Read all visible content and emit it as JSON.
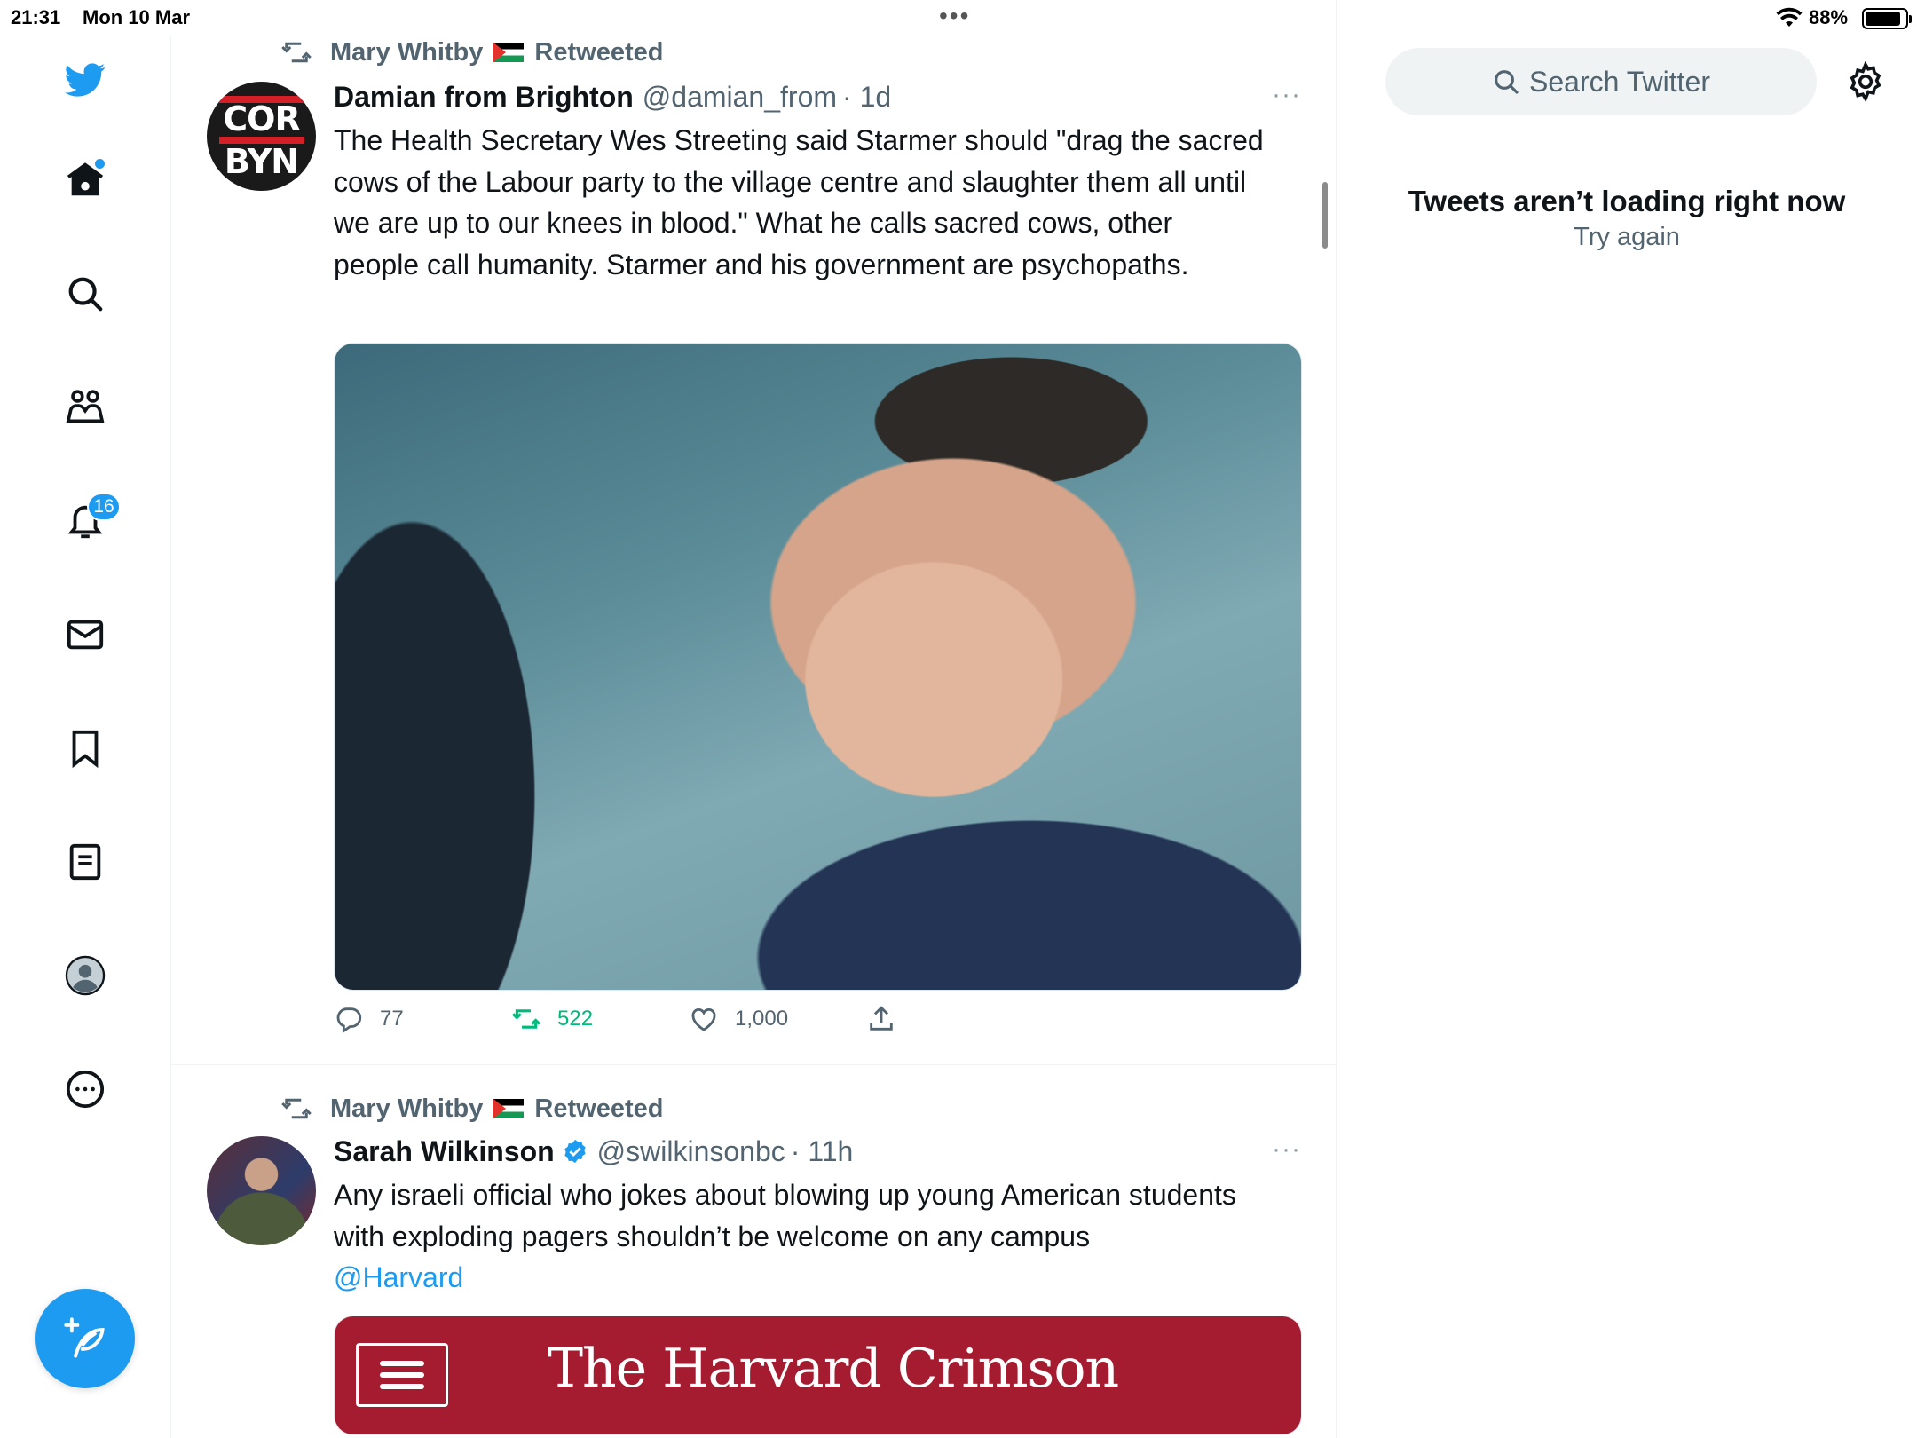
{
  "status_bar": {
    "time": "21:31",
    "date": "Mon 10 Mar",
    "battery_pct": "88%",
    "battery_level": 0.88
  },
  "sidebar": {
    "items": [
      {
        "icon": "twitter-bird-icon"
      },
      {
        "icon": "home-icon",
        "has_dot": true
      },
      {
        "icon": "search-icon"
      },
      {
        "icon": "communities-icon"
      },
      {
        "icon": "notifications-bell-icon",
        "badge": "16"
      },
      {
        "icon": "messages-envelope-icon"
      },
      {
        "icon": "bookmark-icon"
      },
      {
        "icon": "lists-icon"
      },
      {
        "icon": "profile-avatar-icon"
      },
      {
        "icon": "more-circle-icon"
      }
    ],
    "compose_icon": "compose-feather-icon"
  },
  "timeline": {
    "tweets": [
      {
        "retweeted_by": "Mary Whitby",
        "retweeted_label": "Retweeted",
        "author_name": "Damian from Brighton",
        "author_handle": "@damian_from",
        "time": "· 1d",
        "avatar_text_top": "COR",
        "avatar_text_bottom": "BYN",
        "text": "The Health Secretary Wes Streeting said Starmer should \"drag the sacred cows of the Labour party to the village centre and slaughter them all until we are up to our knees in blood.\" What he calls sacred cows, other people call humanity. Starmer and his government are psychopaths.",
        "more": "···",
        "replies": "77",
        "retweets": "522",
        "likes": "1,000"
      },
      {
        "retweeted_by": "Mary Whitby",
        "retweeted_label": "Retweeted",
        "author_name": "Sarah Wilkinson",
        "verified": true,
        "author_handle": "@swilkinsonbc",
        "time": "· 11h",
        "text": "Any israeli official who jokes about blowing up young American students with exploding pagers shouldn’t be welcome on any campus",
        "mention": "@Harvard",
        "more": "···",
        "card_title": "The Harvard Crimson"
      }
    ]
  },
  "right": {
    "search_placeholder": "Search Twitter",
    "error_title": "Tweets aren’t loading right now",
    "retry_label": "Try again"
  },
  "colors": {
    "accent": "#1d9bf0",
    "retweet_green": "#00ba7c",
    "secondary_text": "#536471",
    "crimson": "#a51c30"
  }
}
